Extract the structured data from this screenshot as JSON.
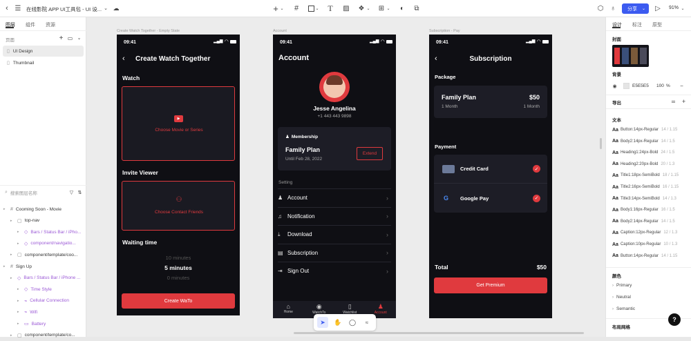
{
  "topbar": {
    "title": "在线影院 APP UI工具包 - UI 设...",
    "share": "分享",
    "zoom": "91%"
  },
  "left": {
    "tabs": [
      "图层",
      "组件",
      "资源"
    ],
    "pages_label": "页面",
    "pages": [
      "UI Design",
      "Thumbnail"
    ],
    "search_placeholder": "搜索图层名称",
    "layers": [
      {
        "t": "Cooming Soon - Movie",
        "ind": 0,
        "k": "frame"
      },
      {
        "t": "top-nav",
        "ind": 1,
        "k": "group"
      },
      {
        "t": "Bars / Status Bar / iPho...",
        "ind": 2,
        "k": "comp"
      },
      {
        "t": "component/navigatio...",
        "ind": 2,
        "k": "comp"
      },
      {
        "t": "component/template/coo...",
        "ind": 1,
        "k": "group"
      },
      {
        "t": "Sign Up",
        "ind": 0,
        "k": "frame"
      },
      {
        "t": "Bars / Status Bar / iPhone ...",
        "ind": 1,
        "k": "comp"
      },
      {
        "t": "Time Style",
        "ind": 2,
        "k": "comp"
      },
      {
        "t": "Cellular Connection",
        "ind": 2,
        "k": "vec"
      },
      {
        "t": "Wifi",
        "ind": 2,
        "k": "vec"
      },
      {
        "t": "Battery",
        "ind": 2,
        "k": "rect"
      },
      {
        "t": "component/template/co...",
        "ind": 1,
        "k": "group"
      }
    ]
  },
  "right": {
    "tabs": [
      "设计",
      "标注",
      "原型"
    ],
    "cover": "封面",
    "bg_label": "背景",
    "bg_hex": "E5E5E5",
    "bg_op": "100",
    "bg_pct": "%",
    "export": "导出",
    "text_label": "文本",
    "styles": [
      {
        "n": "Button:14px-Regular",
        "v": "14 / 1.15"
      },
      {
        "n": "Body2:14px-Regular",
        "v": "14 / 1.5"
      },
      {
        "n": "Heading1:24px-Bold",
        "v": "24 / 1.5"
      },
      {
        "n": "Heading2:20px-Bold",
        "v": "20 / 1.3"
      },
      {
        "n": "Title1:18px-SemiBold",
        "v": "18 / 1.15"
      },
      {
        "n": "Title2:16px-SemiBold",
        "v": "16 / 1.15"
      },
      {
        "n": "Title3:14px-SemiBold",
        "v": "14 / 1.3"
      },
      {
        "n": "Body1:16px-Regular",
        "v": "16 / 1.5"
      },
      {
        "n": "Body2:14px-Regular",
        "v": "14 / 1.5"
      },
      {
        "n": "Caption:12px-Regular",
        "v": "12 / 1.3"
      },
      {
        "n": "Caption:10px-Regular",
        "v": "10 / 1.3"
      },
      {
        "n": "Button:14px-Regular",
        "v": "14 / 1.15"
      }
    ],
    "colors_label": "颜色",
    "colors": [
      "Primary",
      "Neutral",
      "Semantic"
    ],
    "grid_label": "布局网格"
  },
  "frames": {
    "f1": "Create Watch Together - Empty State",
    "f2": "Account",
    "f3": "Subscription - Pay"
  },
  "p1": {
    "time": "09:41",
    "title": "Create Watch Together",
    "watch": "Watch",
    "choose_movie": "Choose Movie or Series",
    "invite": "Invite Viewer",
    "choose_friends": "Choose Contact Friends",
    "waiting": "Waiting time",
    "t1": "10 minutes",
    "t2": "5 minutes",
    "t3": "0 minutes",
    "cta": "Create WaTo"
  },
  "p2": {
    "time": "09:41",
    "title": "Account",
    "name": "Jesse Angelina",
    "phone": "+1 443 443 9898",
    "membership": "Membership",
    "plan": "Family Plan",
    "until": "Until Feb 28, 2022",
    "extend": "Extend",
    "setting": "Setting",
    "items": [
      "Account",
      "Notification",
      "Download",
      "Subscription",
      "Sign Out"
    ],
    "nav": [
      "Home",
      "WatchTo",
      "Watchlist",
      "Account"
    ]
  },
  "p3": {
    "time": "09:41",
    "title": "Subscription",
    "package": "Package",
    "plan": "Family Plan",
    "price": "$50",
    "month1": "1 Month",
    "month2": "1 Month",
    "payment": "Payment",
    "pay1": "Credit Card",
    "pay2": "Google Pay",
    "total": "Total",
    "total_price": "$50",
    "cta": "Get Premium"
  },
  "colors": {
    "accent": "#e03a3e",
    "dark": "#0f0f14",
    "card": "#1d1d26",
    "ui_blue": "#3c5bf0"
  }
}
